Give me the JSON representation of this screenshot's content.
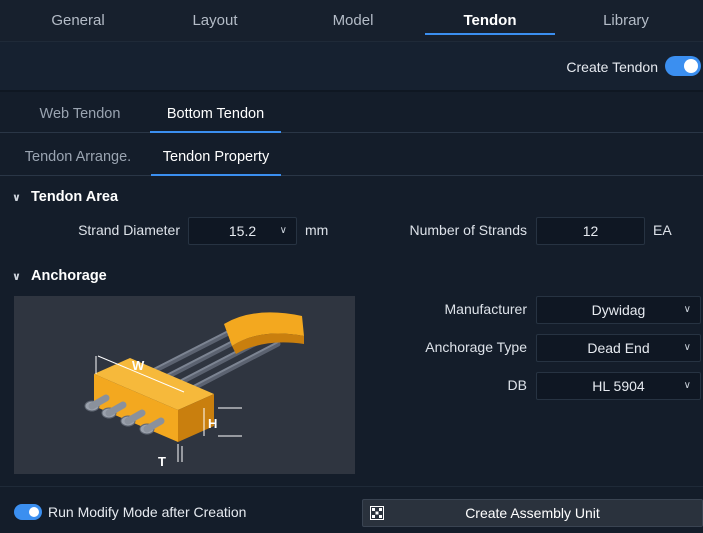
{
  "top_tabs": [
    {
      "label": "General"
    },
    {
      "label": "Layout"
    },
    {
      "label": "Model"
    },
    {
      "label": "Tendon",
      "active": true
    },
    {
      "label": "Library"
    }
  ],
  "create_tendon": {
    "label": "Create Tendon",
    "on": true
  },
  "sub_tabs": [
    {
      "label": "Web Tendon"
    },
    {
      "label": "Bottom Tendon",
      "active": true
    }
  ],
  "prop_tabs": [
    {
      "label": "Tendon Arrange."
    },
    {
      "label": "Tendon Property",
      "active": true
    }
  ],
  "tendon_area": {
    "title": "Tendon Area",
    "strand_diameter": {
      "label": "Strand Diameter",
      "value": "15.2",
      "unit": "mm"
    },
    "number_of_strands": {
      "label": "Number of Strands",
      "value": "12",
      "unit": "EA"
    }
  },
  "anchorage": {
    "title": "Anchorage",
    "manufacturer": {
      "label": "Manufacturer",
      "value": "Dywidag"
    },
    "anchorage_type": {
      "label": "Anchorage Type",
      "value": "Dead End"
    },
    "db": {
      "label": "DB",
      "value": "HL 5904"
    },
    "diagram_labels": {
      "w": "W",
      "h": "H",
      "t": "T"
    }
  },
  "bottom": {
    "run_modify": {
      "label": "Run Modify Mode after Creation",
      "on": true
    },
    "create_button": "Create Assembly Unit"
  },
  "colors": {
    "accent": "#3b8ff0",
    "anchor": "#f3a81f",
    "background": "#141d2a"
  }
}
